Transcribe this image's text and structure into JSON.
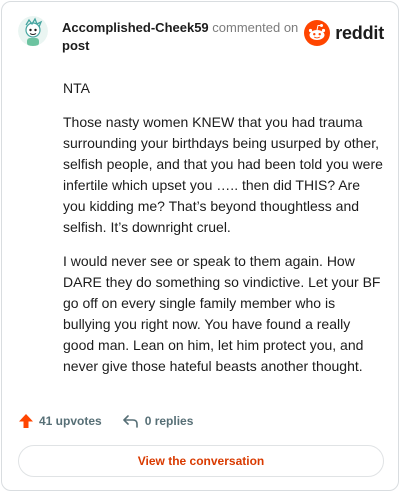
{
  "header": {
    "author": "Accomplished-Cheek59",
    "commented_on": "commented on",
    "post_label": "post",
    "logo_text": "reddit"
  },
  "comment": {
    "paragraphs": [
      "NTA",
      "Those nasty women KNEW that you had trauma surrounding your birthdays being usurped by other, selfish people, and that you had been told you were infertile which upset you ….. then did THIS? Are you kidding me? That’s beyond thoughtless and selfish. It’s downright cruel.",
      "I would never see or speak to them again. How DARE they do something so vindictive. Let your BF go off on every single family member who is bullying you right now. You have found a really good man. Lean on him, let him protect you, and never give those hateful beasts another thought."
    ]
  },
  "footer": {
    "upvotes": "41 upvotes",
    "replies": "0 replies",
    "cta": "View the conversation"
  },
  "colors": {
    "upvote": "#ff4500",
    "cta_text": "#d93a00",
    "reddit_orange": "#ff4500"
  },
  "icons": [
    "avatar-snoo-icon",
    "reddit-logo-icon",
    "upvote-arrow-icon",
    "reply-arrow-icon"
  ]
}
